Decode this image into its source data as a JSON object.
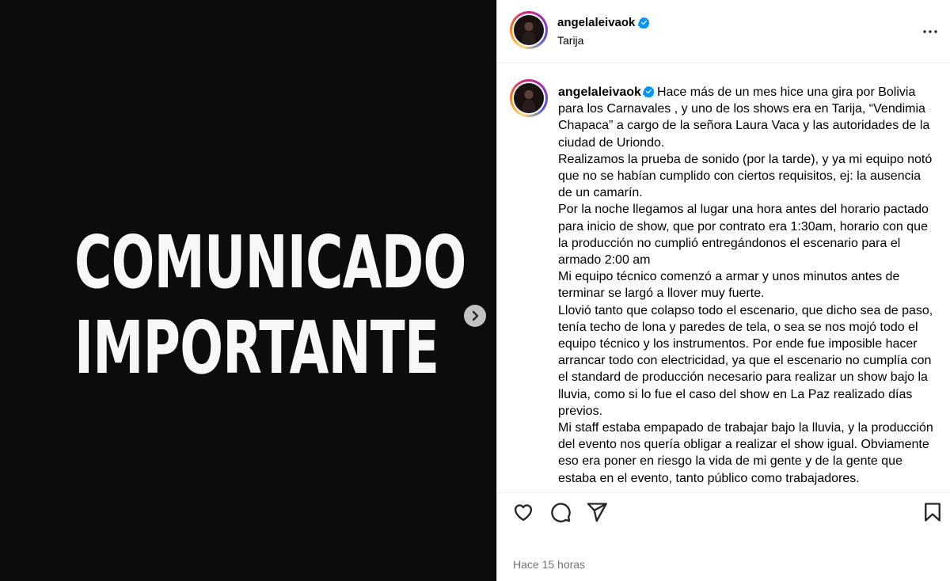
{
  "media": {
    "headline_line1": "COMUNICADO",
    "headline_line2": "IMPORTANTE",
    "next_icon": "chevron-right-icon"
  },
  "header": {
    "username": "angelaleivaok",
    "location": "Tarija",
    "verified_icon": "verified-badge-icon",
    "more_icon": "more-options-icon"
  },
  "caption": {
    "username": "angelaleivaok",
    "paragraphs": [
      "Hace más de un mes hice una gira por Bolivia para los Carnavales , y uno de los shows era en Tarija, “Vendimia Chapaca” a cargo de la señora Laura Vaca y las autoridades de la ciudad de Uriondo.",
      "Realizamos la prueba de sonido (por la tarde), y ya mi equipo notó que no se habían cumplido con ciertos requisitos, ej: la ausencia de un camarín.",
      "Por la noche llegamos al lugar una hora antes del horario pactado para inicio de show, que por contrato era 1:30am, horario con que la producción no cumplió entregándonos el escenario para el armado 2:00 am",
      "Mi equipo técnico comenzó a armar y unos minutos antes de terminar se largó a llover muy fuerte.",
      "Llovió tanto que colapso todo el escenario, que dicho sea de paso, tenía techo de lona y paredes de tela, o sea se nos mojó todo el equipo técnico y los instrumentos. Por ende fue imposible hacer arrancar todo con electricidad, ya que el escenario no cumplía con el standard de producción necesario para realizar un show bajo la lluvia, como si lo fue el caso del show en La Paz realizado días previos.",
      "Mi staff estaba empapado de trabajar bajo la lluvia, y la producción del evento nos quería obligar a realizar el show igual. Obviamente eso era poner en riesgo la vida de mi gente y de la gente que estaba en el evento, tanto público como trabajadores."
    ]
  },
  "actions": {
    "like_icon": "heart-icon",
    "comment_icon": "comment-icon",
    "share_icon": "share-icon",
    "save_icon": "bookmark-icon"
  },
  "timestamp": "Hace 15 horas",
  "colors": {
    "verified": "#0095f6",
    "media_bg": "#0c0c0c",
    "muted_text": "#737373"
  }
}
